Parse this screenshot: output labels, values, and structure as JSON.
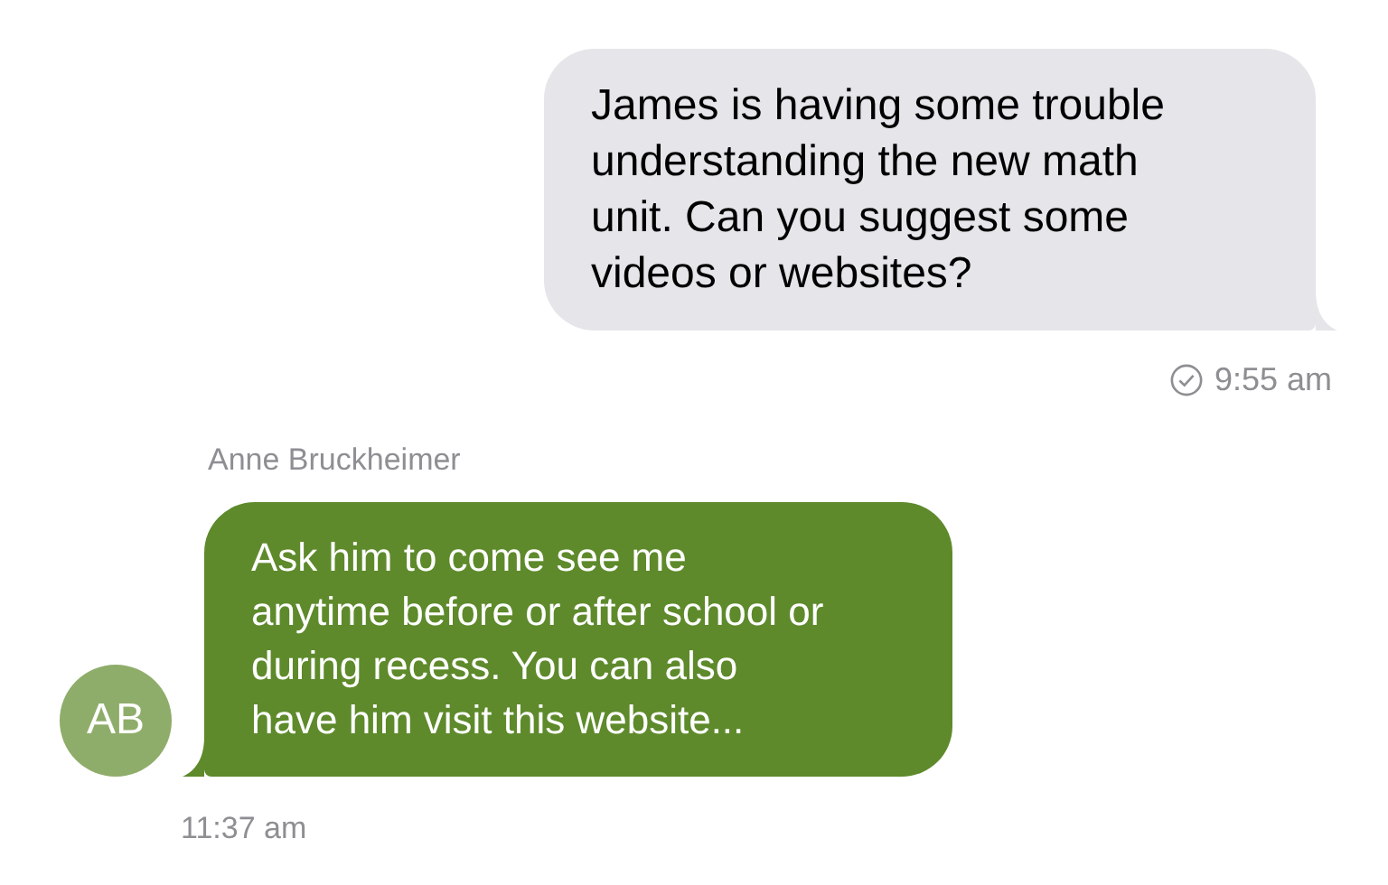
{
  "messages": [
    {
      "kind": "outgoing",
      "text": "James is having some trouble understanding the new math unit. Can you suggest some videos or websites?",
      "time": "9:55 am",
      "read": true
    },
    {
      "kind": "incoming",
      "sender": "Anne Bruckheimer",
      "initials": "AB",
      "text": "Ask him to come see me anytime before or after school or during recess. You can also have him visit this website...",
      "time": "11:37 am"
    }
  ]
}
